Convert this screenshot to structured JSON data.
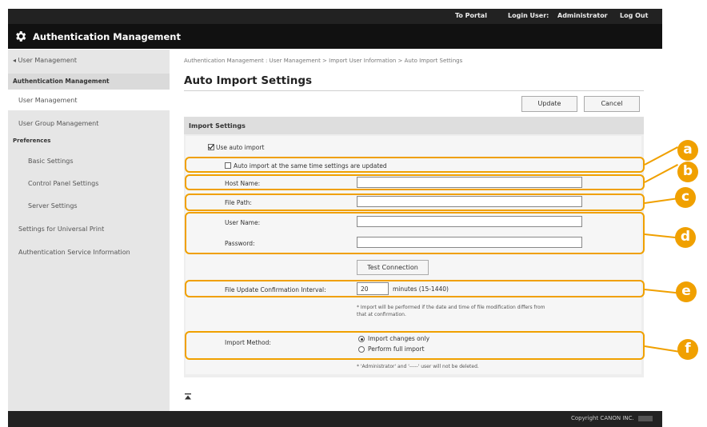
{
  "header": {
    "portal_link": "To Portal",
    "login_user_label": "Login User:",
    "login_user_value": "Administrator",
    "logout_link": "Log Out"
  },
  "app": {
    "title": "Authentication Management",
    "icon": "gear-icon"
  },
  "sidebar": {
    "back_link": "◂ User Management",
    "section_title": "Authentication Management",
    "items": [
      {
        "label": "User Management",
        "selected": true
      },
      {
        "label": "User Group Management"
      },
      {
        "label": "Preferences",
        "heading": true
      },
      {
        "label": "Basic Settings"
      },
      {
        "label": "Control Panel Settings"
      },
      {
        "label": "Server Settings"
      },
      {
        "label": "Settings for Universal Print"
      },
      {
        "label": "Authentication Service Information"
      }
    ]
  },
  "main": {
    "breadcrumb": "Authentication Management : User Management > Import User Information > Auto Import Settings",
    "title": "Auto Import Settings",
    "update_button": "Update",
    "cancel_button": "Cancel",
    "section_title": "Import Settings",
    "use_auto_import": "Use auto import",
    "auto_import_same_time": "Auto import at the same time settings are updated",
    "host_name_label": "Host Name:",
    "file_path_label": "File Path:",
    "user_name_label": "User Name:",
    "password_label": "Password:",
    "test_connection_button": "Test Connection",
    "interval_label": "File Update Confirmation Interval:",
    "interval_value": "20",
    "interval_unit": "minutes (15-1440)",
    "interval_note_line1": "* Import will be performed if the date and time of file modification differs from",
    "interval_note_line2": "that at confirmation.",
    "import_method_label": "Import Method:",
    "import_changes_only": "Import changes only",
    "perform_full_import": "Perform full import",
    "import_method_note": "* 'Administrator' and '-----' user will not be deleted.",
    "top_icon": "to-top-icon"
  },
  "callouts": [
    "a",
    "b",
    "c",
    "d",
    "e",
    "f"
  ],
  "footer": {
    "copyright": "Copyright CANON INC."
  },
  "colors": {
    "callout": "#f0a000",
    "topbar": "#222222",
    "appbar": "#111111",
    "sidebar": "#e6e6e6"
  }
}
